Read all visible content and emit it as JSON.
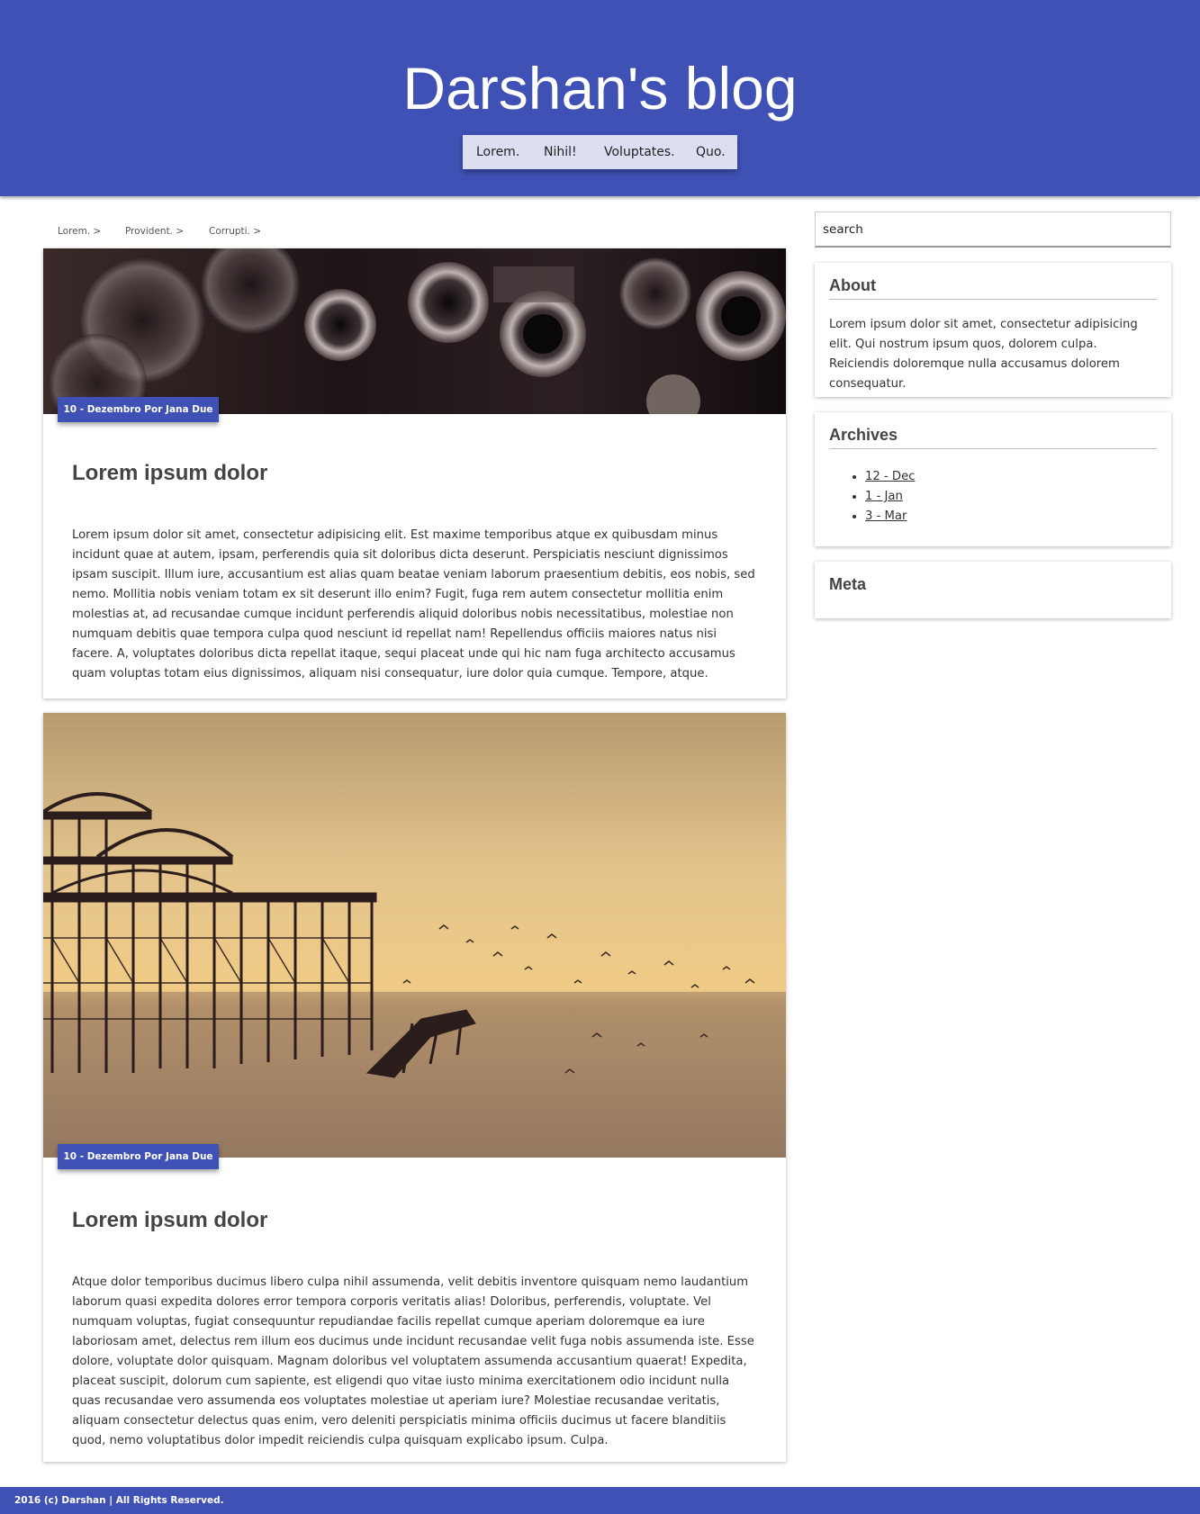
{
  "header": {
    "title": "Darshan's blog",
    "nav": [
      "Lorem.",
      "Nihil!",
      "Voluptates.",
      "Quo."
    ]
  },
  "breadcrumb": [
    "Lorem. >",
    "Provident. >",
    "Corrupti. >"
  ],
  "posts": [
    {
      "meta": "10 - Dezembro Por Jana Due",
      "title": "Lorem ipsum dolor",
      "body": "Lorem ipsum dolor sit amet, consectetur adipisicing elit. Est maxime temporibus atque ex quibusdam minus incidunt quae at autem, ipsam, perferendis quia sit doloribus dicta deserunt. Perspiciatis nesciunt dignissimos ipsam suscipit. Illum iure, accusantium est alias quam beatae veniam laborum praesentium debitis, eos nobis, sed nemo. Mollitia nobis veniam totam ex sit deserunt illo enim? Fugit, fuga rem autem consectetur mollitia enim molestias at, ad recusandae cumque incidunt perferendis aliquid doloribus nobis necessitatibus, molestiae non numquam debitis quae tempora culpa quod nesciunt id repellat nam! Repellendus officiis maiores natus nisi facere. A, voluptates doloribus dicta repellat itaque, sequi placeat unde qui hic nam fuga architecto accusamus quam voluptas totam eius dignissimos, aliquam nisi consequatur, iure dolor quia cumque. Tempore, atque."
    },
    {
      "meta": "10 - Dezembro Por Jana Due",
      "title": "Lorem ipsum dolor",
      "body": "Atque dolor temporibus ducimus libero culpa nihil assumenda, velit debitis inventore quisquam nemo laudantium laborum quasi expedita dolores error tempora corporis veritatis alias! Doloribus, perferendis, voluptate. Vel numquam voluptas, fugiat consequuntur repudiandae facilis repellat cumque aperiam doloremque ea iure laboriosam amet, delectus rem illum eos ducimus unde incidunt recusandae velit fuga nobis assumenda iste. Esse dolore, voluptate dolor quisquam. Magnam doloribus vel voluptatem assumenda accusantium quaerat! Expedita, placeat suscipit, dolorum cum sapiente, est eligendi quo vitae iusto minima exercitationem odio incidunt nulla quas recusandae vero assumenda eos voluptates molestiae ut aperiam iure? Molestiae recusandae veritatis, aliquam consectetur delectus quas enim, vero deleniti perspiciatis minima officiis ducimus ut facere blanditiis quod, nemo voluptatibus dolor impedit reiciendis culpa quisquam explicabo ipsum. Culpa."
    }
  ],
  "sidebar": {
    "search_placeholder": "search",
    "about": {
      "title": "About",
      "text": "Lorem ipsum dolor sit amet, consectetur adipisicing elit. Qui nostrum ipsum quos, dolorem culpa. Reiciendis doloremque nulla accusamus dolorem consequatur."
    },
    "archives": {
      "title": "Archives",
      "items": [
        "12 - Dec",
        "1 - Jan",
        "3 - Mar"
      ]
    },
    "meta": {
      "title": "Meta"
    }
  },
  "footer": {
    "text": "2016 (c) Darshan | All Rights Reserved."
  },
  "colors": {
    "primary": "#3f51b5",
    "nav_bg": "#dcdff1"
  }
}
